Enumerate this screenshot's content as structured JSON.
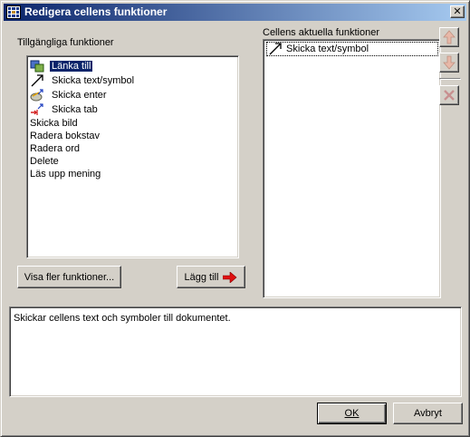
{
  "window": {
    "title": "Redigera cellens funktioner"
  },
  "available": {
    "label": "Tillgängliga funktioner",
    "items": [
      {
        "label": "Länka till",
        "icon": "link-icon",
        "selected": true
      },
      {
        "label": "Skicka text/symbol",
        "icon": "arrow-up-right-icon",
        "selected": false
      },
      {
        "label": "Skicka enter",
        "icon": "enter-icon",
        "selected": false
      },
      {
        "label": "Skicka tab",
        "icon": "tab-icon",
        "selected": false
      },
      {
        "label": "Skicka bild",
        "icon": null,
        "selected": false
      },
      {
        "label": "Radera bokstav",
        "icon": null,
        "selected": false
      },
      {
        "label": "Radera ord",
        "icon": null,
        "selected": false
      },
      {
        "label": "Delete",
        "icon": null,
        "selected": false
      },
      {
        "label": "Läs upp mening",
        "icon": null,
        "selected": false
      }
    ],
    "more_button": "Visa fler funktioner...",
    "add_button": "Lägg till"
  },
  "current": {
    "label": "Cellens aktuella funktioner",
    "items": [
      {
        "label": "Skicka text/symbol",
        "icon": "arrow-up-right-icon"
      }
    ]
  },
  "side_buttons": {
    "up": "arrow-up-icon",
    "down": "arrow-down-icon",
    "remove": "delete-x-icon"
  },
  "description": "Skickar cellens text och symboler till dokumentet.",
  "footer": {
    "ok_label": "OK",
    "cancel_label": "Avbryt"
  },
  "colors": {
    "selection": "#0a246a",
    "face": "#d4d0c8",
    "red_arrow": "#e01010"
  }
}
